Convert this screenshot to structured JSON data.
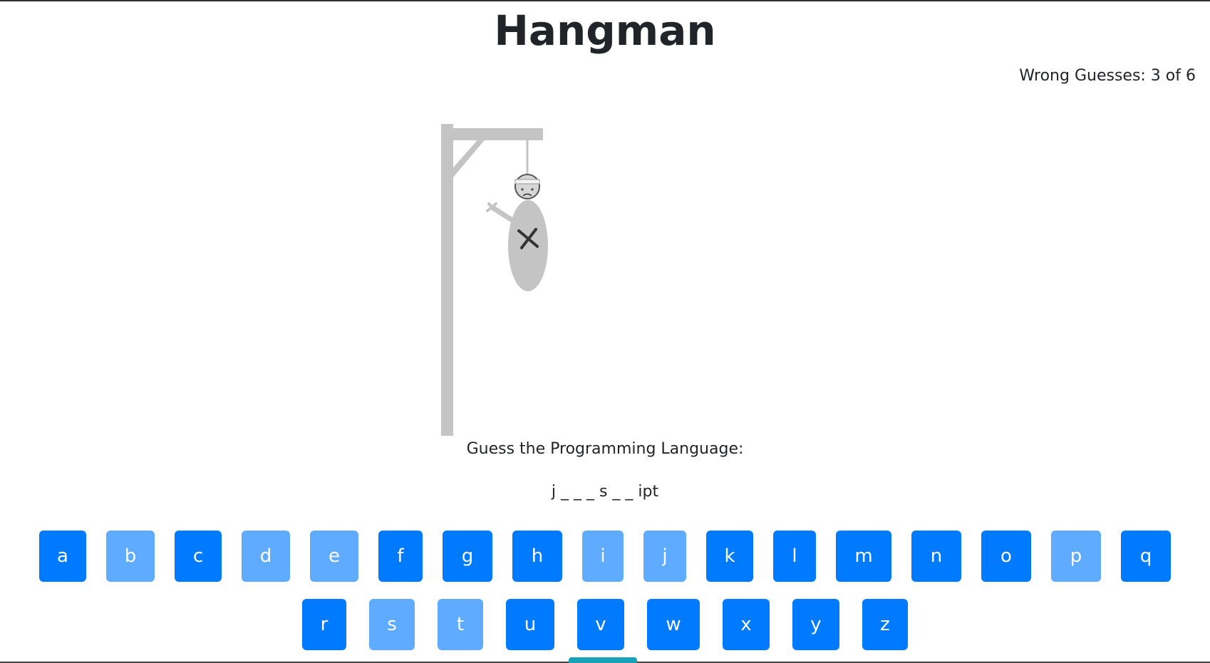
{
  "header": {
    "title": "Hangman"
  },
  "status": {
    "wrong_guesses": "Wrong Guesses: 3 of 6"
  },
  "game": {
    "prompt": "Guess the Programming Language:",
    "word_display": "j _ _ _ s _ _ ipt"
  },
  "keyboard": {
    "row1": [
      {
        "letter": "a",
        "used": false
      },
      {
        "letter": "b",
        "used": true
      },
      {
        "letter": "c",
        "used": false
      },
      {
        "letter": "d",
        "used": true
      },
      {
        "letter": "e",
        "used": true
      },
      {
        "letter": "f",
        "used": false
      },
      {
        "letter": "g",
        "used": false
      },
      {
        "letter": "h",
        "used": false
      },
      {
        "letter": "i",
        "used": true
      },
      {
        "letter": "j",
        "used": true
      },
      {
        "letter": "k",
        "used": false
      },
      {
        "letter": "l",
        "used": false
      },
      {
        "letter": "m",
        "used": false
      },
      {
        "letter": "n",
        "used": false
      },
      {
        "letter": "o",
        "used": false
      },
      {
        "letter": "p",
        "used": true
      },
      {
        "letter": "q",
        "used": false
      }
    ],
    "row2": [
      {
        "letter": "r",
        "used": false
      },
      {
        "letter": "s",
        "used": true
      },
      {
        "letter": "t",
        "used": true
      },
      {
        "letter": "u",
        "used": false
      },
      {
        "letter": "v",
        "used": false
      },
      {
        "letter": "w",
        "used": false
      },
      {
        "letter": "x",
        "used": false
      },
      {
        "letter": "y",
        "used": false
      },
      {
        "letter": "z",
        "used": false
      }
    ]
  },
  "colors": {
    "key_active": "#007bff",
    "key_used": "#5eabff",
    "gallows": "#c4c4c4"
  }
}
